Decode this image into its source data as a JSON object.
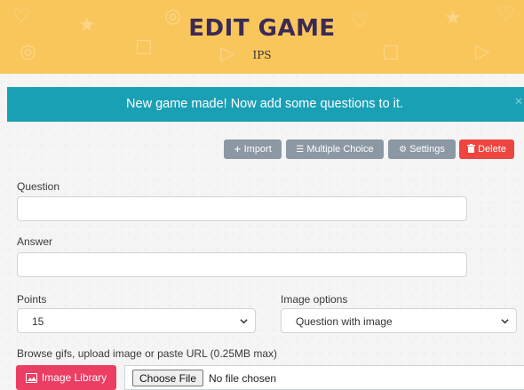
{
  "header": {
    "title": "EDIT GAME",
    "subtitle": "IPS",
    "background_color": "#f9c65c"
  },
  "alert": {
    "message": "New game made! Now add some questions to it.",
    "close_label": "×",
    "color": "#1aa0b5"
  },
  "toolbar": {
    "import_label": "Import",
    "import_icon": "plus-icon",
    "multiple_choice_label": "Multiple Choice",
    "multiple_choice_icon": "list-icon",
    "settings_label": "Settings",
    "settings_icon": "gear-icon",
    "delete_label": "Delete",
    "delete_icon": "trash-icon"
  },
  "form": {
    "question_label": "Question",
    "question_value": "",
    "answer_label": "Answer",
    "answer_value": "",
    "points_label": "Points",
    "points_value": "15",
    "image_options_label": "Image options",
    "image_options_value": "Question with image",
    "browse_label": "Browse gifs, upload image or paste URL (0.25MB max)",
    "image_library_label": "Image Library",
    "image_library_icon": "image-icon",
    "choose_file_label": "Choose File",
    "file_status": "No file chosen"
  },
  "colors": {
    "gray_button": "#8c98a4",
    "red_button": "#ef4540",
    "pink_button": "#ec3d63"
  }
}
